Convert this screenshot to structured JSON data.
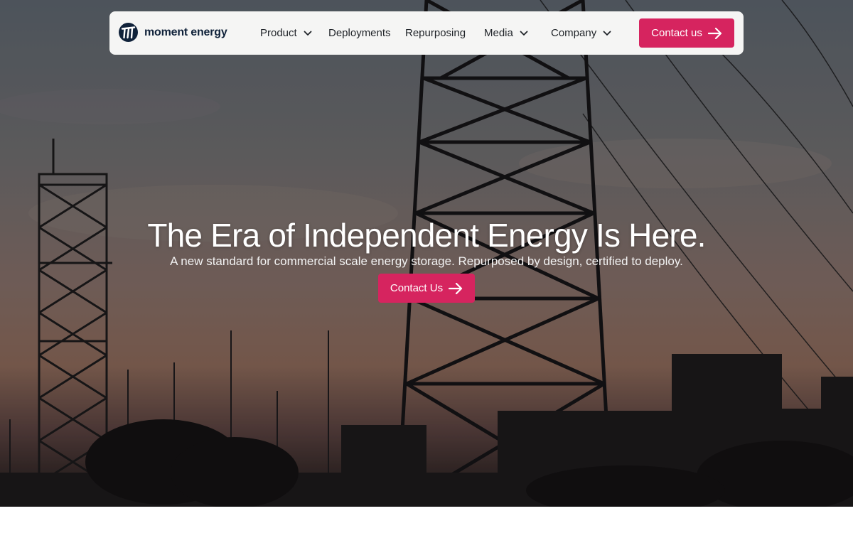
{
  "brand": {
    "name": "moment energy",
    "accent_color": "#d6245f",
    "logo_color": "#10223a"
  },
  "nav": {
    "items": [
      {
        "label": "Product",
        "has_dropdown": true
      },
      {
        "label": "Deployments",
        "has_dropdown": false
      },
      {
        "label": "Repurposing",
        "has_dropdown": false
      },
      {
        "label": "Media",
        "has_dropdown": true
      },
      {
        "label": "Company",
        "has_dropdown": true
      }
    ],
    "cta_label": "Contact us",
    "cta_icon": "arrow-right-icon",
    "dropdown_icon": "chevron-down-icon"
  },
  "hero": {
    "headline": "The Era of Independent Energy Is Here.",
    "subheadline": "A new standard for commercial scale energy storage. Repurposed by design, certified to deploy.",
    "cta_label": "Contact Us",
    "cta_icon": "arrow-right-icon",
    "background": "electrical-transmission-tower-at-dusk"
  }
}
